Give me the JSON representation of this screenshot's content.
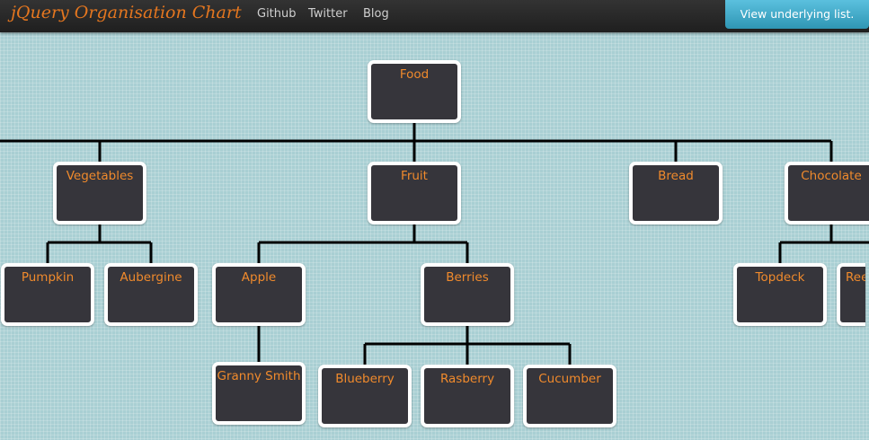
{
  "navbar": {
    "brand": "jQuery Organisation Chart",
    "links": [
      "Github",
      "Twitter",
      "Blog"
    ],
    "view_list_button": "View underlying list."
  },
  "tree": {
    "label": "Food",
    "children": [
      {
        "label": "Vegetables",
        "children": [
          {
            "label": "Pumpkin"
          },
          {
            "label": "Aubergine"
          }
        ]
      },
      {
        "label": "Fruit",
        "children": [
          {
            "label": "Apple",
            "children": [
              {
                "label": "Granny Smith"
              }
            ]
          },
          {
            "label": "Berries",
            "children": [
              {
                "label": "Blueberry"
              },
              {
                "label": "Rasberry"
              },
              {
                "label": "Cucumber"
              }
            ]
          }
        ]
      },
      {
        "label": "Bread"
      },
      {
        "label": "Chocolate",
        "children": [
          {
            "label": "Topdeck"
          },
          {
            "label": "Reese's"
          }
        ]
      }
    ]
  },
  "colors": {
    "background": "#a9cfd3",
    "node_fill": "#36353b",
    "node_border": "#ffffff",
    "label": "#f08a2c",
    "brand": "#e4761f",
    "button": "#49afcd"
  }
}
